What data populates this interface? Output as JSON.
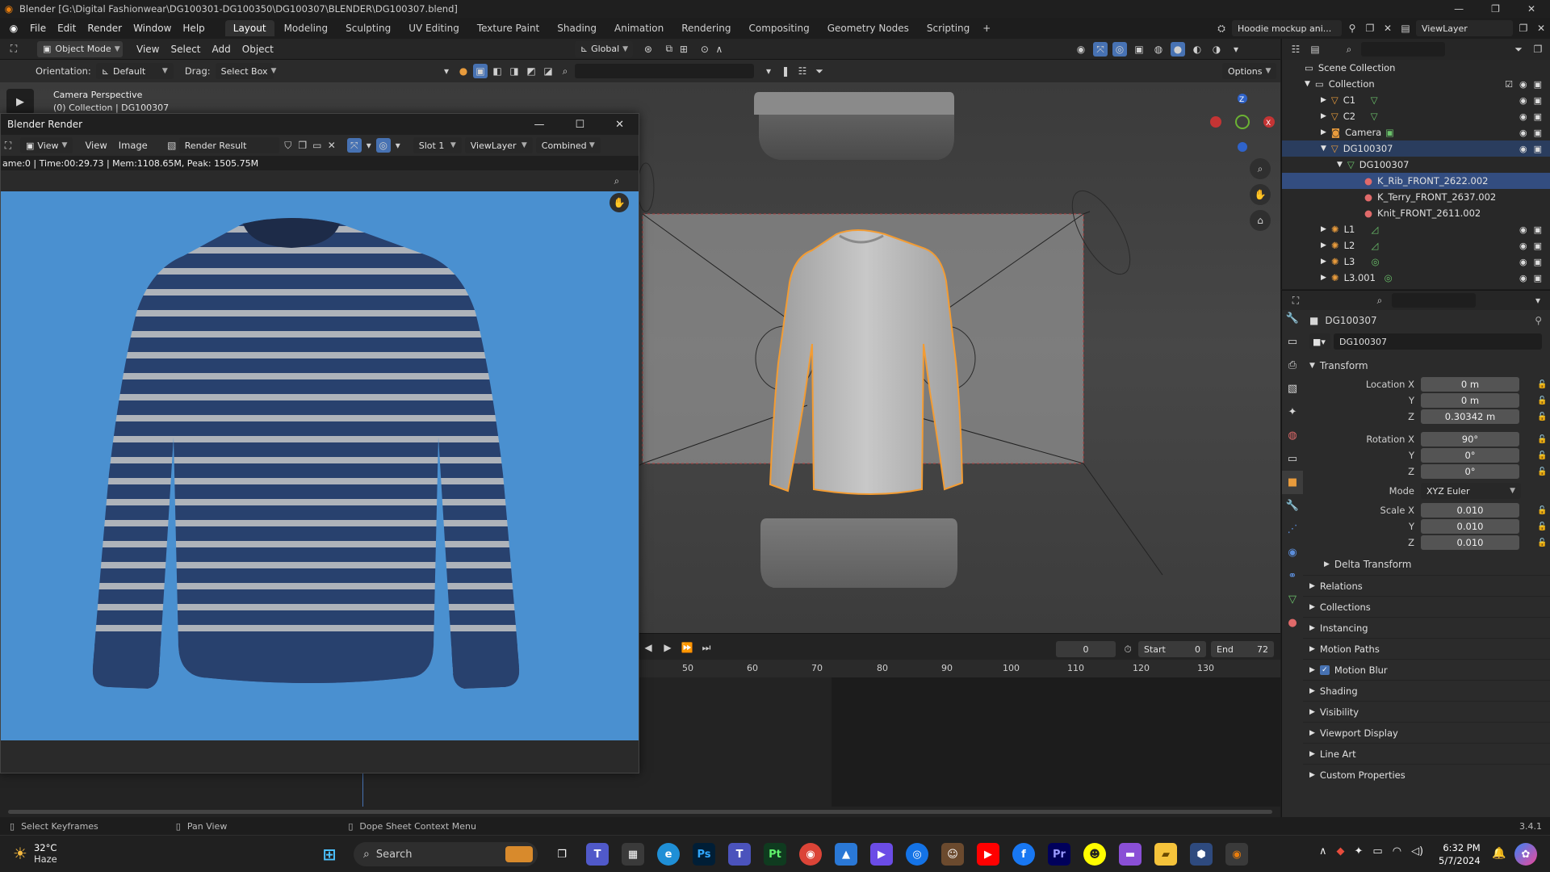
{
  "window": {
    "title": "Blender [G:\\Digital Fashionwear\\DG100301-DG100350\\DG100307\\BLENDER\\DG100307.blend]"
  },
  "menu": [
    "File",
    "Edit",
    "Render",
    "Window",
    "Help"
  ],
  "workspaces": [
    "Layout",
    "Modeling",
    "Sculpting",
    "UV Editing",
    "Texture Paint",
    "Shading",
    "Animation",
    "Rendering",
    "Compositing",
    "Geometry Nodes",
    "Scripting"
  ],
  "scene_name": "Hoodie mockup ani...",
  "view_layer": "ViewLayer",
  "viewport_header": {
    "mode": "Object Mode",
    "menus": [
      "View",
      "Select",
      "Add",
      "Object"
    ],
    "transform_orientation": "Global"
  },
  "tool_options": {
    "orientation_label": "Orientation:",
    "orientation_value": "Default",
    "drag_label": "Drag:",
    "drag_value": "Select Box",
    "options_label": "Options"
  },
  "viewport_overlay": {
    "line1": "Camera Perspective",
    "line2": "(0) Collection | DG100307"
  },
  "render_window": {
    "title": "Blender Render",
    "menus": [
      "View",
      "View",
      "Image"
    ],
    "image_name": "Render Result",
    "slot": "Slot 1",
    "view_layer": "ViewLayer",
    "pass": "Combined",
    "info": "ame:0 | Time:00:29.73 | Mem:1108.65M, Peak: 1505.75M"
  },
  "timeline": {
    "current_frame": "0",
    "start_label": "Start",
    "start": "0",
    "end_label": "End",
    "end": "72",
    "ticks": [
      "50",
      "60",
      "70",
      "80",
      "90",
      "100",
      "110",
      "120",
      "130"
    ]
  },
  "outliner": {
    "scene_collection": "Scene Collection",
    "collection": "Collection",
    "items": [
      {
        "name": "C1"
      },
      {
        "name": "C2"
      },
      {
        "name": "Camera"
      },
      {
        "name": "DG100307"
      },
      {
        "name": "DG100307"
      },
      {
        "name": "K_Rib_FRONT_2622.002"
      },
      {
        "name": "K_Terry_FRONT_2637.002"
      },
      {
        "name": "Knit_FRONT_2611.002"
      },
      {
        "name": "L1"
      },
      {
        "name": "L2"
      },
      {
        "name": "L3"
      },
      {
        "name": "L3.001"
      }
    ]
  },
  "properties": {
    "object_name": "DG100307",
    "data_name": "DG100307",
    "transform_label": "Transform",
    "location": {
      "label_x": "Location X",
      "x": "0 m",
      "y": "0 m",
      "z": "0.30342 m"
    },
    "rotation": {
      "label_x": "Rotation X",
      "x": "90°",
      "y": "0°",
      "z": "0°"
    },
    "mode_label": "Mode",
    "mode_value": "XYZ Euler",
    "scale": {
      "label_x": "Scale X",
      "x": "0.010",
      "y": "0.010",
      "z": "0.010"
    },
    "axis_y": "Y",
    "axis_z": "Z",
    "delta_transform": "Delta Transform",
    "sections": [
      "Relations",
      "Collections",
      "Instancing",
      "Motion Paths",
      "Motion Blur",
      "Shading",
      "Visibility",
      "Viewport Display",
      "Line Art",
      "Custom Properties"
    ]
  },
  "status_bar": {
    "left": "Select Keyframes",
    "middle": "Pan View",
    "right": "Dope Sheet Context Menu",
    "version": "3.4.1"
  },
  "taskbar": {
    "weather_temp": "32°C",
    "weather_desc": "Haze",
    "search_placeholder": "Search",
    "time": "6:32 PM",
    "date": "5/7/2024"
  },
  "colors": {
    "accent": "#4772b3",
    "selection": "#334d80",
    "render_bg": "#4a90d0",
    "outline": "#f39c33"
  }
}
